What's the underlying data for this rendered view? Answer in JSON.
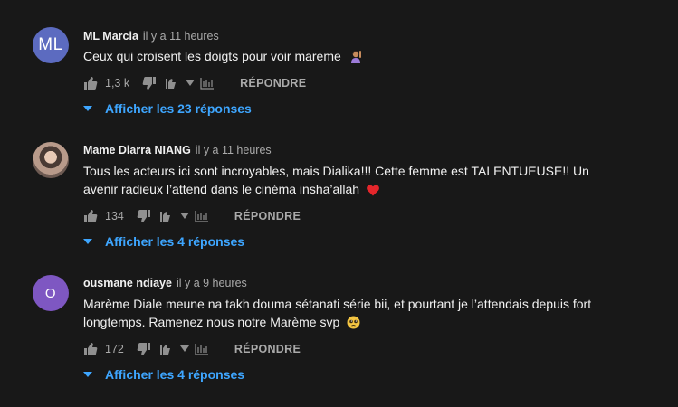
{
  "comments": [
    {
      "avatar_text": "ML",
      "avatar_color": "#5c6bc0",
      "author": "ML Marcia",
      "time": "il y a 11 heures",
      "text": "Ceux qui croisent les doigts pour voir mareme",
      "emoji": "person-raising-hand",
      "likes": "1,3 k",
      "reply_label": "RÉPONDRE",
      "replies_label": "Afficher les 23 réponses"
    },
    {
      "avatar_text": "",
      "avatar_color": "#6d5a52",
      "author": "Mame Diarra NIANG",
      "time": "il y a 11 heures",
      "text": "Tous les acteurs ici sont incroyables, mais Dialika!!! Cette femme est TALENTUEUSE!! Un avenir radieux l’attend dans le cinéma insha’allah",
      "emoji": "red-heart",
      "likes": "134",
      "reply_label": "RÉPONDRE",
      "replies_label": "Afficher les 4 réponses"
    },
    {
      "avatar_text": "O",
      "avatar_color": "#7e57c2",
      "author": "ousmane ndiaye",
      "time": "il y a 9 heures",
      "text": "Marème Diale meune na takh douma sétanati série bii, et pourtant je l’attendais depuis fort longtemps. Ramenez nous notre Marème svp",
      "emoji": "pleading-face",
      "likes": "172",
      "reply_label": "RÉPONDRE",
      "replies_label": "Afficher les 4 réponses"
    }
  ],
  "colors": {
    "background": "#181818",
    "link": "#3ea6ff",
    "secondary_text": "#aaaaaa",
    "primary_text": "#f1f1f1"
  }
}
